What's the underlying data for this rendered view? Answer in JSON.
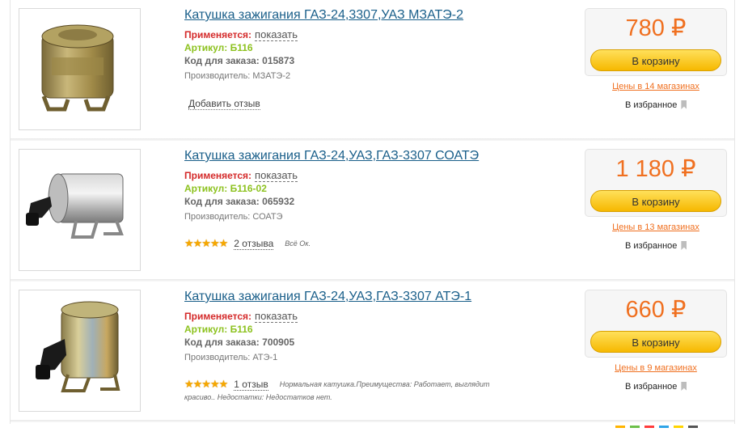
{
  "products": [
    {
      "title": "Катушка зажигания ГАЗ-24,3307,УАЗ МЗАТЭ-2",
      "applies_label": "Применяется:",
      "applies_link": "показать",
      "article": "Артикул: Б116",
      "order_code": "Код для заказа: 015873",
      "maker": "Производитель: МЗАТЭ-2",
      "add_review": "Добавить отзыв",
      "price": "780 ₽",
      "cart_label": "В корзину",
      "shops": "Цены в 14 магазинах",
      "favorite": "В избранное"
    },
    {
      "title": "Катушка зажигания ГАЗ-24,УАЗ,ГАЗ-3307 СОАТЭ",
      "applies_label": "Применяется:",
      "applies_link": "показать",
      "article": "Артикул: Б116-02",
      "order_code": "Код для заказа: 065932",
      "maker": "Производитель: СОАТЭ",
      "rating_stars": 5,
      "reviews_link": "2 отзыва",
      "review_text": "Всё Ок.",
      "price": "1 180 ₽",
      "cart_label": "В корзину",
      "shops": "Цены в 13 магазинах",
      "favorite": "В избранное"
    },
    {
      "title": "Катушка зажигания ГАЗ-24,УАЗ,ГАЗ-3307 АТЭ-1",
      "applies_label": "Применяется:",
      "applies_link": "показать",
      "article": "Артикул: Б116",
      "order_code": "Код для заказа: 700905",
      "maker": "Производитель: АТЭ-1",
      "rating_stars": 5,
      "reviews_link": "1 отзыв",
      "review_text": "Нормальная катушка.Преимущества: Работает, выглядит",
      "review_text_2": "красиво.. Недостатки: Недостатков нет.",
      "price": "660 ₽",
      "cart_label": "В корзину",
      "shops": "Цены в 9 магазинах",
      "favorite": "В избранное"
    }
  ],
  "colors": {
    "title_link": "#1a5f8a",
    "applies_red": "#d42a2a",
    "article_green": "#8dc21f",
    "price_orange": "#f07020",
    "cart_yellow": "#f6b800",
    "star_gold": "#f6a800"
  },
  "icons": [
    "bookmark-icon",
    "star-icon"
  ],
  "divider_dot_colors": [
    "#ffb400",
    "#6cc04a",
    "#ff3b3b",
    "#2fa4e7",
    "#ffd400",
    "#555555"
  ]
}
